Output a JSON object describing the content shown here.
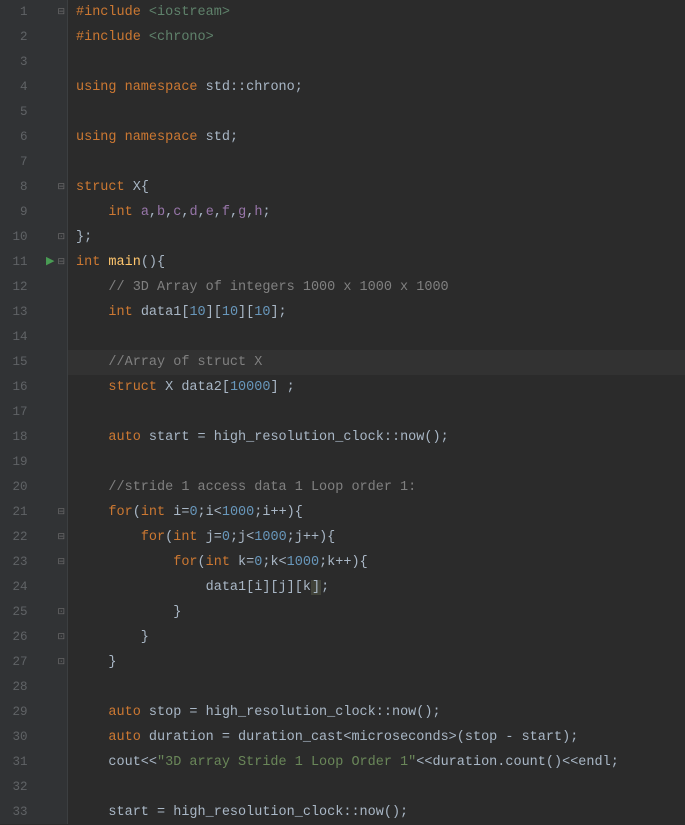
{
  "lines": [
    {
      "n": 1,
      "marker": "fold-start",
      "tokens": [
        [
          "kw",
          "#include"
        ],
        [
          "punct",
          " "
        ],
        [
          "incl",
          "<iostream>"
        ]
      ]
    },
    {
      "n": 2,
      "marker": "",
      "tokens": [
        [
          "kw",
          "#include"
        ],
        [
          "punct",
          " "
        ],
        [
          "incl",
          "<chrono>"
        ]
      ]
    },
    {
      "n": 3,
      "marker": "",
      "tokens": []
    },
    {
      "n": 4,
      "marker": "",
      "tokens": [
        [
          "kw",
          "using namespace "
        ],
        [
          "ident",
          "std"
        ],
        [
          "punct",
          "::"
        ],
        [
          "ident",
          "chrono"
        ],
        [
          "punct",
          ";"
        ]
      ]
    },
    {
      "n": 5,
      "marker": "",
      "tokens": []
    },
    {
      "n": 6,
      "marker": "",
      "tokens": [
        [
          "kw",
          "using namespace "
        ],
        [
          "ident",
          "std"
        ],
        [
          "punct",
          ";"
        ]
      ]
    },
    {
      "n": 7,
      "marker": "",
      "tokens": []
    },
    {
      "n": 8,
      "marker": "fold-block",
      "tokens": [
        [
          "kw",
          "struct "
        ],
        [
          "ident",
          "X"
        ],
        [
          "punct",
          "{"
        ]
      ]
    },
    {
      "n": 9,
      "marker": "",
      "tokens": [
        [
          "punct",
          "    "
        ],
        [
          "kw",
          "int "
        ],
        [
          "purple",
          "a"
        ],
        [
          "punct",
          ","
        ],
        [
          "purple",
          "b"
        ],
        [
          "punct",
          ","
        ],
        [
          "purple",
          "c"
        ],
        [
          "punct",
          ","
        ],
        [
          "purple",
          "d"
        ],
        [
          "punct",
          ","
        ],
        [
          "purple",
          "e"
        ],
        [
          "punct",
          ","
        ],
        [
          "purple",
          "f"
        ],
        [
          "punct",
          ","
        ],
        [
          "purple",
          "g"
        ],
        [
          "punct",
          ","
        ],
        [
          "purple",
          "h"
        ],
        [
          "punct",
          ";"
        ]
      ]
    },
    {
      "n": 10,
      "marker": "fold-end",
      "tokens": [
        [
          "punct",
          "};"
        ]
      ]
    },
    {
      "n": 11,
      "marker": "run",
      "tokens": [
        [
          "kw",
          "int "
        ],
        [
          "func",
          "main"
        ],
        [
          "punct",
          "(){"
        ]
      ]
    },
    {
      "n": 12,
      "marker": "",
      "tokens": [
        [
          "punct",
          "    "
        ],
        [
          "comment",
          "// 3D Array of integers 1000 x 1000 x 1000"
        ]
      ]
    },
    {
      "n": 13,
      "marker": "",
      "tokens": [
        [
          "punct",
          "    "
        ],
        [
          "kw",
          "int "
        ],
        [
          "ident",
          "data1"
        ],
        [
          "punct",
          "["
        ],
        [
          "num",
          "10"
        ],
        [
          "punct",
          "]["
        ],
        [
          "num",
          "10"
        ],
        [
          "punct",
          "]["
        ],
        [
          "num",
          "10"
        ],
        [
          "punct",
          "];"
        ]
      ]
    },
    {
      "n": 14,
      "marker": "",
      "tokens": []
    },
    {
      "n": 15,
      "marker": "",
      "cursor": true,
      "tokens": [
        [
          "punct",
          "    "
        ],
        [
          "comment",
          "//Array of struct X"
        ]
      ]
    },
    {
      "n": 16,
      "marker": "",
      "tokens": [
        [
          "punct",
          "    "
        ],
        [
          "kw",
          "struct "
        ],
        [
          "ident",
          "X data2"
        ],
        [
          "punct",
          "["
        ],
        [
          "num",
          "10000"
        ],
        [
          "punct",
          "] ;"
        ]
      ]
    },
    {
      "n": 17,
      "marker": "",
      "tokens": []
    },
    {
      "n": 18,
      "marker": "",
      "tokens": [
        [
          "punct",
          "    "
        ],
        [
          "kw",
          "auto "
        ],
        [
          "ident",
          "start = high_resolution_clock"
        ],
        [
          "punct",
          "::"
        ],
        [
          "ident",
          "now"
        ],
        [
          "punct",
          "();"
        ]
      ]
    },
    {
      "n": 19,
      "marker": "",
      "tokens": []
    },
    {
      "n": 20,
      "marker": "",
      "tokens": [
        [
          "punct",
          "    "
        ],
        [
          "comment",
          "//stride 1 access data 1 Loop order 1:"
        ]
      ]
    },
    {
      "n": 21,
      "marker": "fold-block",
      "tokens": [
        [
          "punct",
          "    "
        ],
        [
          "kw",
          "for"
        ],
        [
          "punct",
          "("
        ],
        [
          "kw",
          "int "
        ],
        [
          "ident",
          "i="
        ],
        [
          "num",
          "0"
        ],
        [
          "punct",
          ";i<"
        ],
        [
          "num",
          "1000"
        ],
        [
          "punct",
          ";i++){"
        ]
      ]
    },
    {
      "n": 22,
      "marker": "fold-block",
      "tokens": [
        [
          "punct",
          "        "
        ],
        [
          "kw",
          "for"
        ],
        [
          "punct",
          "("
        ],
        [
          "kw",
          "int "
        ],
        [
          "ident",
          "j="
        ],
        [
          "num",
          "0"
        ],
        [
          "punct",
          ";j<"
        ],
        [
          "num",
          "1000"
        ],
        [
          "punct",
          ";j++){"
        ]
      ]
    },
    {
      "n": 23,
      "marker": "fold-block",
      "tokens": [
        [
          "punct",
          "            "
        ],
        [
          "kw",
          "for"
        ],
        [
          "punct",
          "("
        ],
        [
          "kw",
          "int "
        ],
        [
          "ident",
          "k="
        ],
        [
          "num",
          "0"
        ],
        [
          "punct",
          ";k<"
        ],
        [
          "num",
          "1000"
        ],
        [
          "punct",
          ";k++){"
        ]
      ]
    },
    {
      "n": 24,
      "marker": "",
      "tokens": [
        [
          "punct",
          "                data1[i][j][k"
        ],
        [
          "caret",
          "]"
        ],
        [
          "punct",
          ";"
        ]
      ]
    },
    {
      "n": 25,
      "marker": "fold-end",
      "tokens": [
        [
          "punct",
          "            }"
        ]
      ]
    },
    {
      "n": 26,
      "marker": "fold-end",
      "tokens": [
        [
          "punct",
          "        }"
        ]
      ]
    },
    {
      "n": 27,
      "marker": "fold-end",
      "tokens": [
        [
          "punct",
          "    }"
        ]
      ]
    },
    {
      "n": 28,
      "marker": "",
      "tokens": []
    },
    {
      "n": 29,
      "marker": "",
      "tokens": [
        [
          "punct",
          "    "
        ],
        [
          "kw",
          "auto "
        ],
        [
          "ident",
          "stop = high_resolution_clock"
        ],
        [
          "punct",
          "::"
        ],
        [
          "ident",
          "now"
        ],
        [
          "punct",
          "();"
        ]
      ]
    },
    {
      "n": 30,
      "marker": "",
      "tokens": [
        [
          "punct",
          "    "
        ],
        [
          "kw",
          "auto "
        ],
        [
          "ident",
          "duration = duration_cast<microseconds>(stop - start)"
        ],
        [
          "punct",
          ";"
        ]
      ]
    },
    {
      "n": 31,
      "marker": "",
      "tokens": [
        [
          "punct",
          "    cout<<"
        ],
        [
          "str",
          "\"3D array Stride 1 Loop Order 1\""
        ],
        [
          "punct",
          "<<duration.count()<<endl;"
        ]
      ]
    },
    {
      "n": 32,
      "marker": "",
      "tokens": []
    },
    {
      "n": 33,
      "marker": "",
      "tokens": [
        [
          "punct",
          "    start = high_resolution_clock"
        ],
        [
          "punct",
          "::"
        ],
        [
          "ident",
          "now"
        ],
        [
          "punct",
          "();"
        ]
      ]
    }
  ]
}
